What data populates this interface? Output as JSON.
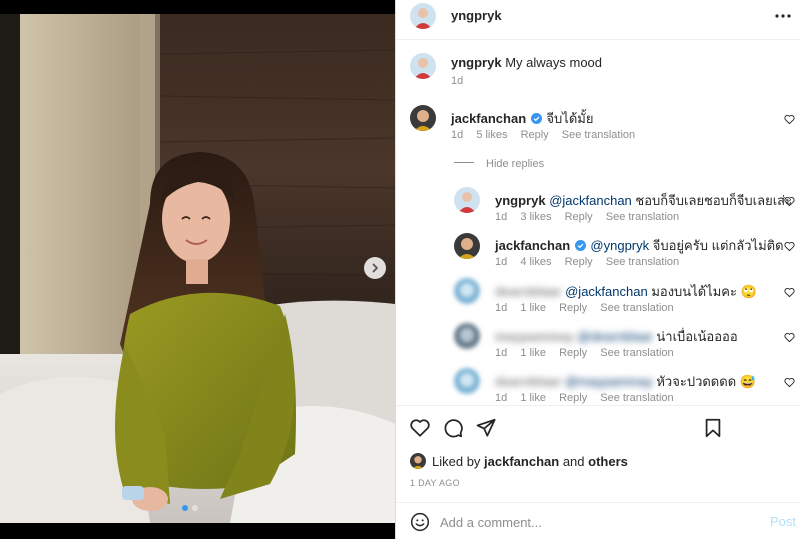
{
  "post": {
    "owner": "yngpryk",
    "caption": "My always mood",
    "caption_time": "1d"
  },
  "comments": [
    {
      "user": "jackfanchan",
      "verified": true,
      "text": "จีบได้มั้ย",
      "time": "1d",
      "likes": "5 likes",
      "reply": "Reply",
      "translate": "See translation"
    }
  ],
  "hide_replies": "Hide replies",
  "replies": [
    {
      "user": "yngpryk",
      "verified": false,
      "mention": "@jackfanchan",
      "text": "ชอบก็จีบเลยชอบก็จีบเลยเส่ะ",
      "time": "1d",
      "likes": "3 likes",
      "reply": "Reply",
      "translate": "See translation",
      "blurred_user": false
    },
    {
      "user": "jackfanchan",
      "verified": true,
      "mention": "@yngpryk",
      "text": "จีบอยู่ครับ แต่กลัวไม่ติด",
      "time": "1d",
      "likes": "4 likes",
      "reply": "Reply",
      "translate": "See translation",
      "blurred_user": false
    },
    {
      "user": "dearnblaar",
      "mention": "@jackfanchan",
      "text": "มองบนได้ไมคะ 🙄",
      "time": "1d",
      "likes": "1 like",
      "reply": "Reply",
      "translate": "See translation",
      "blurred_user": true,
      "blurred_mention": false
    },
    {
      "user": "maypammay",
      "mention": "@dearnblaar",
      "text": "น่าเบื่อเน้ออออ",
      "time": "1d",
      "likes": "1 like",
      "reply": "Reply",
      "translate": "See translation",
      "blurred_user": true,
      "blurred_mention": true
    },
    {
      "user": "dearnblaar",
      "mention": "@maypammay",
      "text": "หัวจะปวดดดด 😅",
      "time": "1d",
      "likes": "1 like",
      "reply": "Reply",
      "translate": "See translation",
      "blurred_user": true,
      "blurred_mention": true
    }
  ],
  "liked_by": {
    "prefix": "Liked by",
    "user": "jackfanchan",
    "and": "and",
    "others": "others"
  },
  "time_ago": "1 DAY AGO",
  "add_comment": {
    "placeholder": "Add a comment...",
    "post_label": "Post"
  },
  "icons": {
    "like": "heart-icon",
    "comment": "comment-bubble-icon",
    "share": "paper-plane-icon",
    "save": "bookmark-icon",
    "more": "more-horizontal-icon",
    "next": "chevron-right-icon",
    "emoji": "emoji-icon",
    "verified": "verified-badge-icon"
  },
  "colors": {
    "verified": "#3797f0",
    "mention": "#00376b",
    "secondary_text": "#8e8e8e",
    "post_button_disabled": "#b2dffc"
  }
}
